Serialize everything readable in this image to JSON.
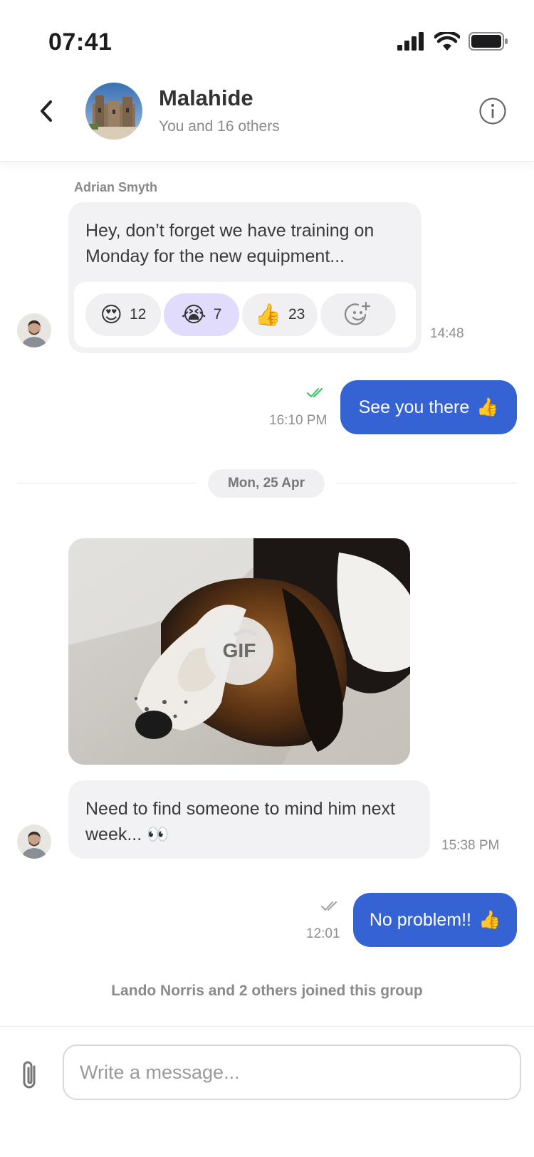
{
  "status_bar": {
    "time": "07:41"
  },
  "header": {
    "title": "Malahide",
    "subtitle": "You and 16 others"
  },
  "messages": {
    "first": {
      "sender": "Adrian Smyth",
      "text_line1": "Hey, don’t forget we have training on",
      "text_line2": "Monday for the new equipment...",
      "time": "14:48",
      "reactions": [
        {
          "emoji": "😍",
          "count": "12"
        },
        {
          "emoji": "😭",
          "count": "7"
        },
        {
          "emoji": "👍",
          "count": "23"
        }
      ]
    },
    "reply1": {
      "text": "See you there",
      "emoji": "👍",
      "time": "16:10 PM"
    },
    "date_divider": "Mon, 25 Apr",
    "gif": {
      "badge": "GIF"
    },
    "second": {
      "text_line1": "Need to find someone to mind him next",
      "text_line2": "week...",
      "emoji": "👀",
      "time": "15:38 PM"
    },
    "reply2": {
      "text": "No problem!!",
      "emoji": "👍",
      "time": "12:01"
    },
    "system": "Lando Norris and 2 others joined this group"
  },
  "composer": {
    "placeholder": "Write a message..."
  },
  "colors": {
    "accent": "#3663d3",
    "read_receipt": "#34c759",
    "bubble_in": "#f2f2f4",
    "reaction_active": "#e1dcfb"
  }
}
